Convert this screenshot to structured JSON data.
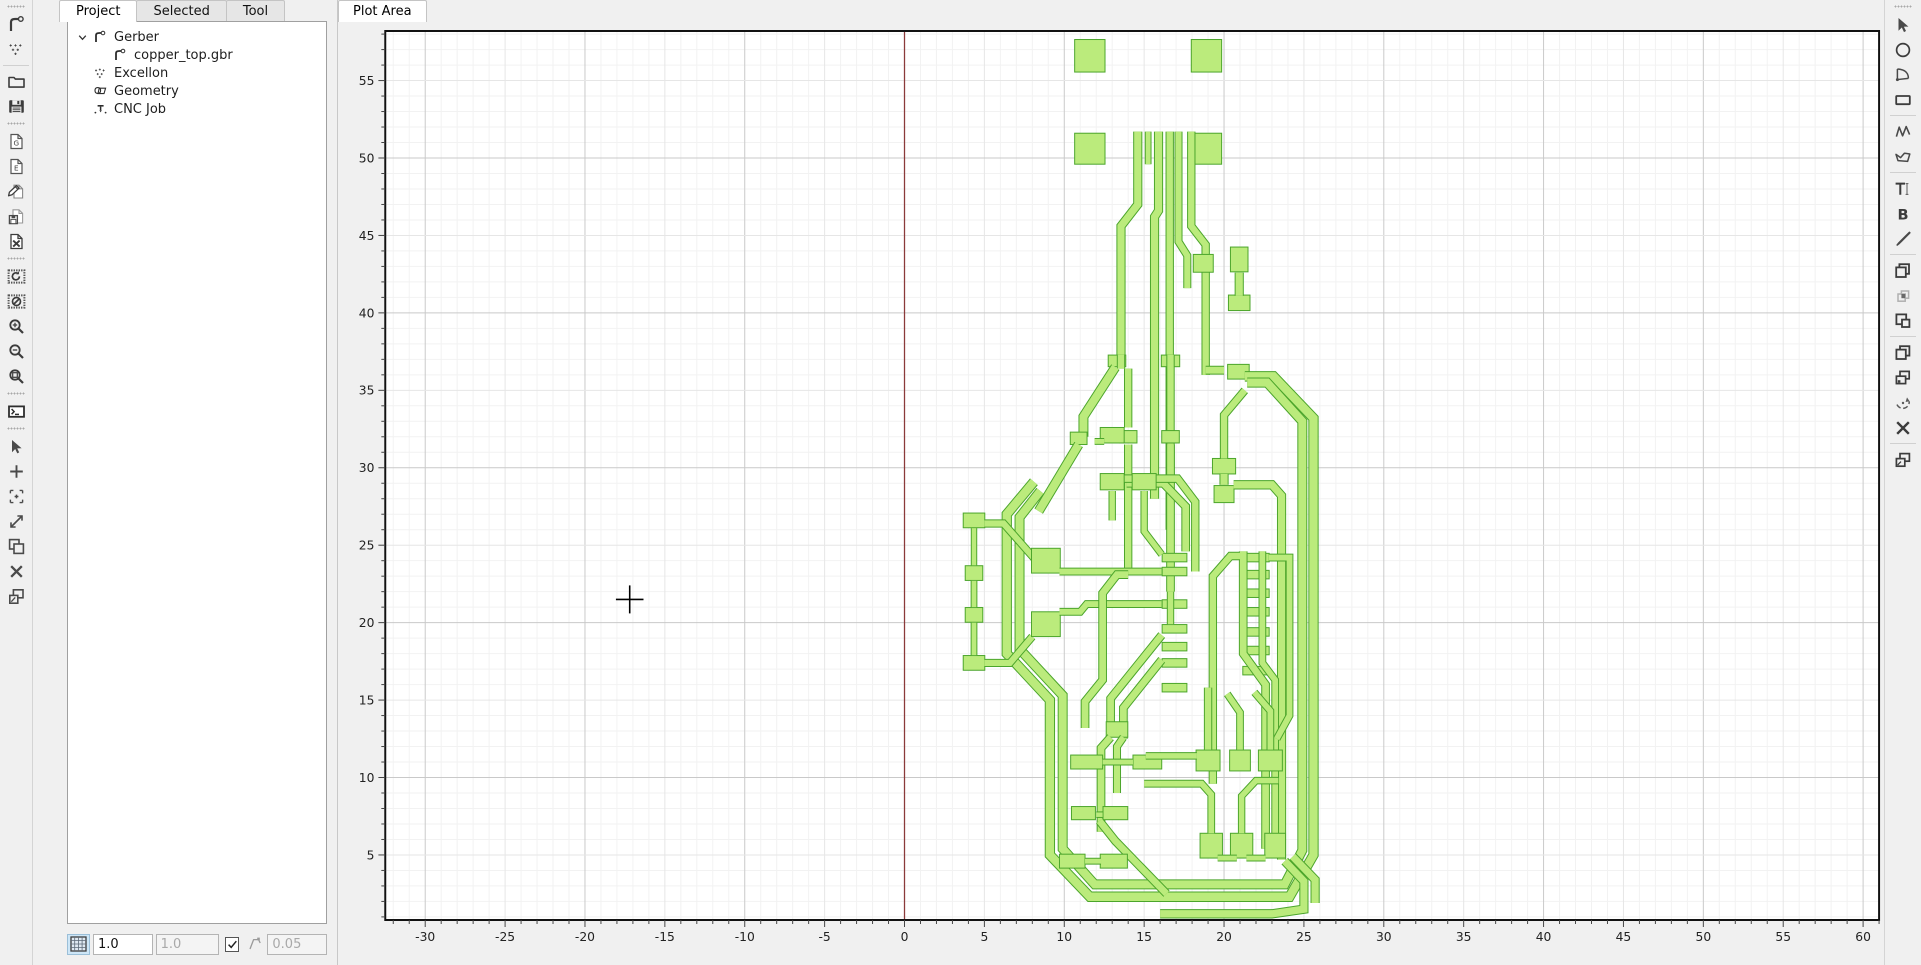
{
  "app": {
    "name": "FlatCAM"
  },
  "left_toolbar": {
    "groups": [
      {
        "buttons": [
          {
            "name": "open-gerber-icon",
            "label": "Open Gerber"
          },
          {
            "name": "open-excellon-icon",
            "label": "Open Excellon"
          }
        ]
      },
      {
        "buttons": [
          {
            "name": "open-project-folder-icon",
            "label": "Open Project"
          },
          {
            "name": "save-project-icon",
            "label": "Save Project"
          }
        ]
      },
      {
        "buttons": [
          {
            "name": "new-gerber-document-icon",
            "label": "New Gerber Object"
          },
          {
            "name": "new-excellon-document-icon",
            "label": "New Excellon Object"
          },
          {
            "name": "edit-object-icon",
            "label": "Edit Object"
          },
          {
            "name": "save-object-icon",
            "label": "Save Object"
          },
          {
            "name": "delete-object-icon",
            "label": "Delete Object"
          }
        ]
      },
      {
        "buttons": [
          {
            "name": "replot-all-icon",
            "label": "Replot All"
          },
          {
            "name": "clear-plot-icon",
            "label": "Clear Plot"
          },
          {
            "name": "zoom-in-icon",
            "label": "Zoom In"
          },
          {
            "name": "zoom-out-icon",
            "label": "Zoom Out"
          },
          {
            "name": "zoom-fit-icon",
            "label": "Zoom Fit"
          }
        ]
      },
      {
        "buttons": [
          {
            "name": "shell-console-icon",
            "label": "Command Line / Shell"
          }
        ]
      },
      {
        "buttons": [
          {
            "name": "select-cursor-icon",
            "label": "Select"
          },
          {
            "name": "add-drill-icon",
            "label": "Add Drill Hole"
          },
          {
            "name": "add-drill-array-icon",
            "label": "Add Drill Array"
          },
          {
            "name": "resize-drill-icon",
            "label": "Resize Drill"
          },
          {
            "name": "copy-drill-icon",
            "label": "Copy Drill"
          },
          {
            "name": "delete-drill-icon",
            "label": "Delete Drill"
          },
          {
            "name": "move-drill-icon",
            "label": "Move Drill"
          }
        ]
      }
    ]
  },
  "right_toolbar": {
    "groups": [
      {
        "buttons": [
          {
            "name": "select-cursor-icon",
            "label": "Select"
          },
          {
            "name": "add-circle-icon",
            "label": "Add Circle"
          },
          {
            "name": "add-arc-icon",
            "label": "Add Arc"
          },
          {
            "name": "add-rectangle-icon",
            "label": "Add Rectangle"
          }
        ]
      },
      {
        "buttons": [
          {
            "name": "add-polyline-icon",
            "label": "Add Path"
          },
          {
            "name": "add-polygon-icon",
            "label": "Add Polygon"
          }
        ]
      },
      {
        "buttons": [
          {
            "name": "add-text-icon",
            "label": "Add Text"
          },
          {
            "name": "add-buffer-icon",
            "label": "Add Buffer"
          },
          {
            "name": "paint-shape-icon",
            "label": "Paint Shape"
          }
        ]
      },
      {
        "buttons": [
          {
            "name": "union-shapes-icon",
            "label": "Polygon Union"
          },
          {
            "name": "intersection-shapes-icon",
            "label": "Polygon Intersection"
          },
          {
            "name": "subtraction-shapes-icon",
            "label": "Polygon Subtraction"
          }
        ]
      },
      {
        "buttons": [
          {
            "name": "cut-path-icon",
            "label": "Cut Path"
          },
          {
            "name": "copy-shape-icon",
            "label": "Copy Shape(s)"
          },
          {
            "name": "transform-shape-icon",
            "label": "Transform Shape"
          },
          {
            "name": "delete-shape-icon",
            "label": "Delete Shape"
          }
        ]
      },
      {
        "buttons": [
          {
            "name": "move-shape-icon",
            "label": "Move Objects"
          }
        ]
      }
    ]
  },
  "project_panel": {
    "tabs": [
      {
        "id": "project",
        "label": "Project",
        "active": true
      },
      {
        "id": "selected",
        "label": "Selected",
        "active": false
      },
      {
        "id": "tool",
        "label": "Tool",
        "active": false
      }
    ],
    "tree": [
      {
        "label": "Gerber",
        "icon": "gerber-icon",
        "depth": 0,
        "expanded": true,
        "has_children": true
      },
      {
        "label": "copper_top.gbr",
        "icon": "gerber-icon",
        "depth": 1,
        "expanded": false,
        "has_children": false
      },
      {
        "label": "Excellon",
        "icon": "excellon-icon",
        "depth": 0,
        "expanded": false,
        "has_children": false
      },
      {
        "label": "Geometry",
        "icon": "geometry-icon",
        "depth": 0,
        "expanded": false,
        "has_children": false
      },
      {
        "label": "CNC Job",
        "icon": "cncjob-icon",
        "depth": 0,
        "expanded": false,
        "has_children": false
      }
    ],
    "grid_bar": {
      "grid_toggle_icon": "grid-icon",
      "grid_toggle_active": true,
      "grid_x_value": "1.0",
      "grid_y_value": "1.0",
      "grid_link_checked": true,
      "snap_icon": "snap-magnet-icon",
      "snap_value": "0.05"
    }
  },
  "plot_panel": {
    "tabs": [
      {
        "id": "plot-area",
        "label": "Plot Area",
        "active": true
      }
    ]
  },
  "chart_data": {
    "type": "scatter",
    "title": "",
    "xlabel": "",
    "ylabel": "",
    "xlim": [
      -32.5,
      61.0
    ],
    "ylim": [
      0.8,
      58.2
    ],
    "grid": true,
    "legend": null,
    "x_ticks": [
      -30,
      -25,
      -20,
      -15,
      -10,
      -5,
      0,
      5,
      10,
      15,
      20,
      25,
      30,
      35,
      40,
      45,
      50,
      55,
      60
    ],
    "y_ticks": [
      5,
      10,
      15,
      20,
      25,
      30,
      35,
      40,
      45,
      50,
      55
    ],
    "minor_tick_step": 1,
    "axis_origin_line": {
      "x": 0,
      "color": "#8b3a3a"
    },
    "cursor_marker": {
      "x": -17.2,
      "y": 21.5,
      "glyph": "crosshair"
    },
    "object": {
      "name": "copper_top.gbr",
      "fill_color": "#bbeb7c",
      "stroke_color": "#4ba52b",
      "units": "mm",
      "bounds": {
        "xmin": 2.2,
        "xmax": 27.0,
        "ymin": 0.9,
        "ymax": 57.4
      }
    }
  }
}
